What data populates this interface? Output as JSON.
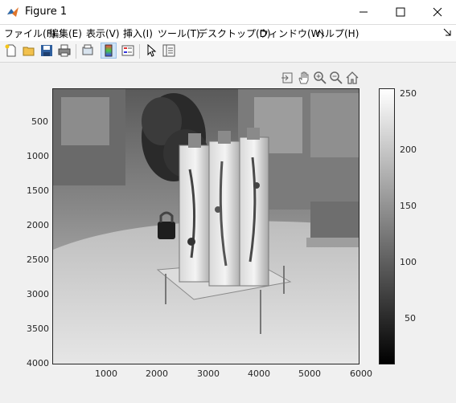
{
  "window": {
    "title": "Figure 1"
  },
  "menu": {
    "items": [
      "ファイル(F)",
      "編集(E)",
      "表示(V)",
      "挿入(I)",
      "ツール(T)",
      "デスクトップ(D)",
      "ウィンドウ(W)",
      "ヘルプ(H)"
    ]
  },
  "toolbar": {
    "buttons": [
      "new-figure",
      "open-file",
      "save",
      "print",
      "print-preview",
      "link-plot",
      "insert-colorbar",
      "insert-legend",
      "edit-plot",
      "property-inspector"
    ]
  },
  "axes_toolbar": [
    "export",
    "pan",
    "zoom-in",
    "zoom-out",
    "restore-view"
  ],
  "chart_data": {
    "type": "heatmap",
    "description_ui": "image",
    "colormap": "gray",
    "x_ticks": [
      "1000",
      "2000",
      "3000",
      "4000",
      "5000",
      "6000"
    ],
    "y_ticks": [
      "500",
      "1000",
      "1500",
      "2000",
      "2500",
      "3000",
      "3500",
      "4000"
    ],
    "xlim": [
      0,
      6000
    ],
    "ylim": [
      0,
      4000
    ],
    "colorbar_ticks": [
      "250",
      "200",
      "150",
      "100",
      "50"
    ],
    "colorbar_range": [
      0,
      255
    ]
  }
}
